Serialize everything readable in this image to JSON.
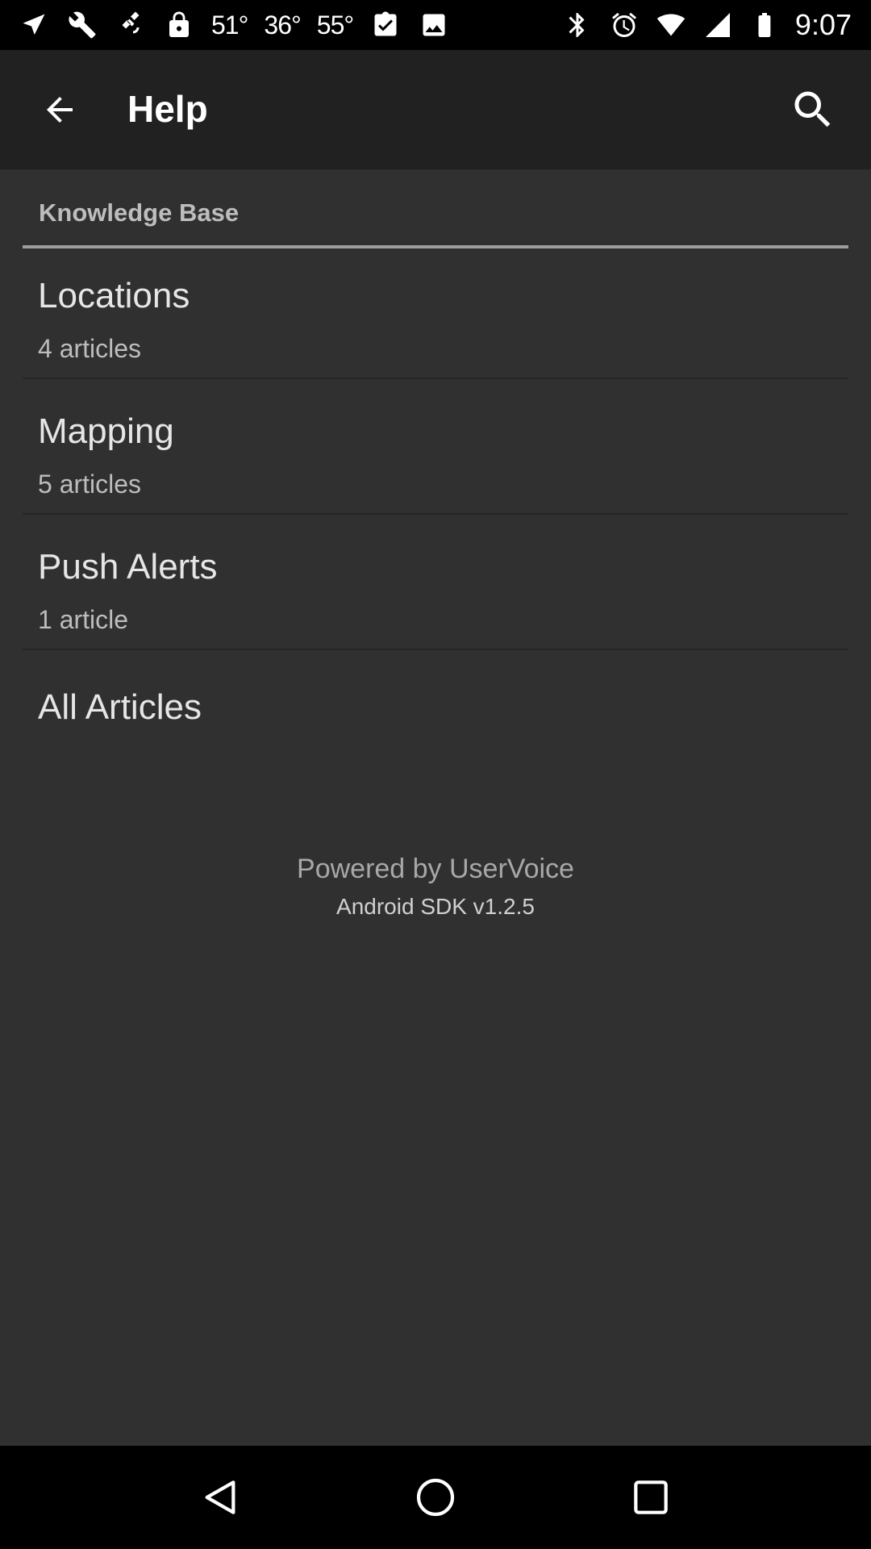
{
  "status_bar": {
    "temps": [
      "51°",
      "36°",
      "55°"
    ],
    "time": "9:07",
    "left_icons": [
      "navigation-icon",
      "wrench-icon",
      "satellite-icon",
      "lock-icon"
    ],
    "right_icons": [
      "clipboard-check-icon",
      "image-icon",
      "bluetooth-icon",
      "alarm-icon",
      "wifi-icon",
      "signal-icon",
      "battery-icon"
    ]
  },
  "app_bar": {
    "title": "Help",
    "back_icon": "arrow-back-icon",
    "search_icon": "search-icon"
  },
  "knowledge_base": {
    "header": "Knowledge Base",
    "items": [
      {
        "title": "Locations",
        "subtitle": "4 articles"
      },
      {
        "title": "Mapping",
        "subtitle": "5 articles"
      },
      {
        "title": "Push Alerts",
        "subtitle": "1 article"
      }
    ],
    "all_articles": "All Articles"
  },
  "footer": {
    "powered_by": "Powered by UserVoice",
    "sdk_version": "Android SDK v1.2.5"
  },
  "nav_bar": {
    "icons": [
      "back-triangle-icon",
      "home-circle-icon",
      "recents-square-icon"
    ]
  }
}
